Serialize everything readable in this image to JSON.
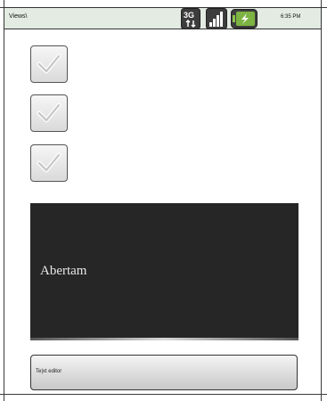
{
  "status_bar": {
    "title": "Views\\",
    "time": "6:35 PM",
    "icons": [
      "3g-data-icon",
      "signal-strength-icon",
      "battery-charging-icon"
    ]
  },
  "checkboxes": [
    {
      "checked": true
    },
    {
      "checked": true
    },
    {
      "checked": true
    }
  ],
  "panel": {
    "label": "Abertam"
  },
  "text_editor": {
    "value": "Te|xt editor"
  }
}
